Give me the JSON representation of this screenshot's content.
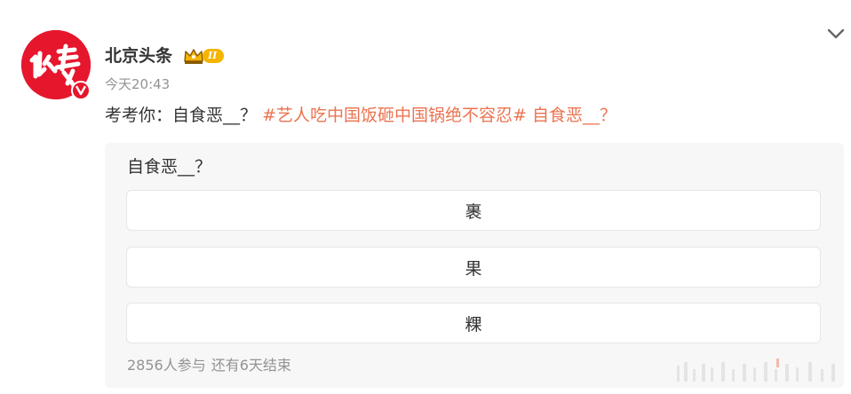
{
  "post": {
    "author": "北京头条",
    "vip_level": "II",
    "timestamp": "今天20:43",
    "text_prefix": "考考你：自食恶__？",
    "hashtag": "#艺人吃中国饭砸中国锅绝不容忍#",
    "text_suffix": "自食恶__？"
  },
  "avatar": {
    "icon": "beijing-toutiao-logo",
    "color": "#e6162d",
    "verified_icon": "verified-v-icon"
  },
  "poll": {
    "question": "自食恶__？",
    "options": [
      {
        "label": "裹"
      },
      {
        "label": "果"
      },
      {
        "label": "粿"
      }
    ],
    "participants": "2856人参与",
    "remaining": "还有6天结束"
  },
  "colors": {
    "link": "#eb7350",
    "muted": "#939393",
    "card_bg": "#f7f7f7"
  },
  "menu": {
    "icon": "chevron-down-icon"
  }
}
